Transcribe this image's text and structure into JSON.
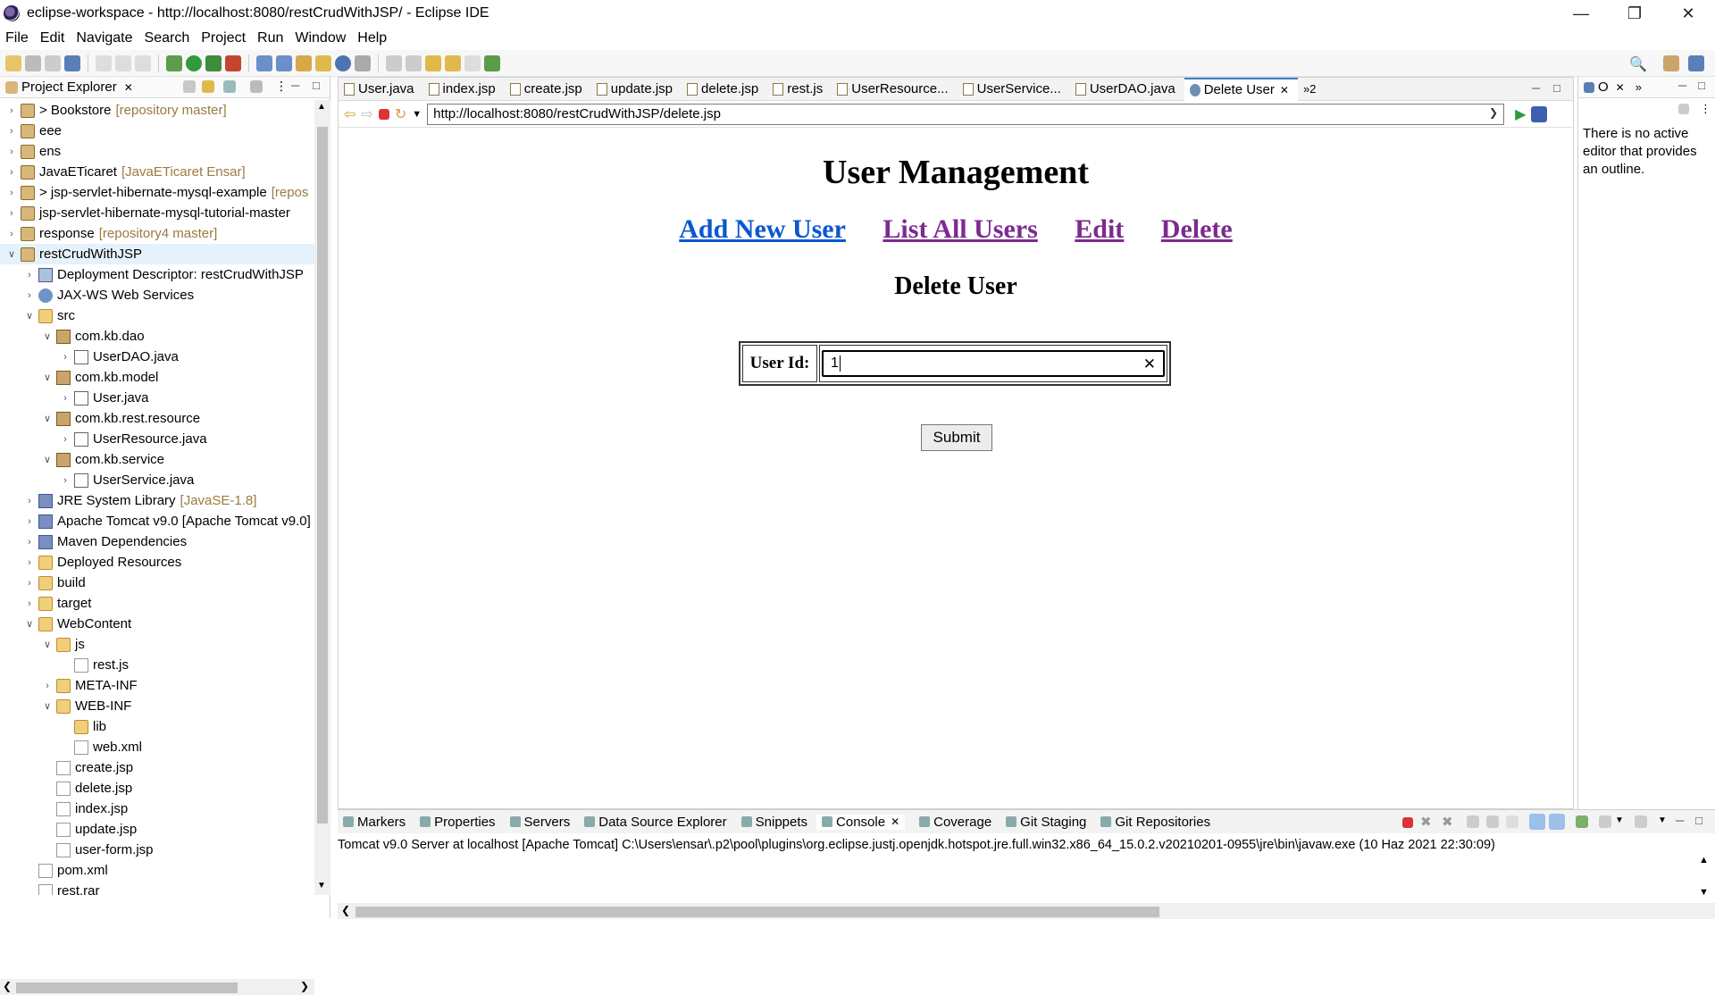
{
  "window": {
    "title": "eclipse-workspace - http://localhost:8080/restCrudWithJSP/ - Eclipse IDE"
  },
  "menu": [
    "File",
    "Edit",
    "Navigate",
    "Search",
    "Project",
    "Run",
    "Window",
    "Help"
  ],
  "explorer": {
    "title": "Project Explorer",
    "items": [
      {
        "label": "> Bookstore",
        "deco": "[repository master]",
        "indent": 0,
        "arrow": ">",
        "icon": "proj"
      },
      {
        "label": "eee",
        "deco": "",
        "indent": 0,
        "arrow": ">",
        "icon": "proj"
      },
      {
        "label": "ens",
        "deco": "",
        "indent": 0,
        "arrow": ">",
        "icon": "proj"
      },
      {
        "label": "JavaETicaret",
        "deco": "[JavaETicaret Ensar]",
        "indent": 0,
        "arrow": ">",
        "icon": "proj"
      },
      {
        "label": "> jsp-servlet-hibernate-mysql-example",
        "deco": "[repos",
        "indent": 0,
        "arrow": ">",
        "icon": "proj"
      },
      {
        "label": "jsp-servlet-hibernate-mysql-tutorial-master",
        "deco": "",
        "indent": 0,
        "arrow": ">",
        "icon": "proj"
      },
      {
        "label": "response",
        "deco": "[repository4 master]",
        "indent": 0,
        "arrow": ">",
        "icon": "proj"
      },
      {
        "label": "restCrudWithJSP",
        "deco": "",
        "indent": 0,
        "arrow": "v",
        "icon": "proj",
        "selected": true
      },
      {
        "label": "Deployment Descriptor: restCrudWithJSP",
        "deco": "",
        "indent": 1,
        "arrow": ">",
        "icon": "dd"
      },
      {
        "label": "JAX-WS Web Services",
        "deco": "",
        "indent": 1,
        "arrow": ">",
        "icon": "ws"
      },
      {
        "label": "src",
        "deco": "",
        "indent": 1,
        "arrow": "v",
        "icon": "folder"
      },
      {
        "label": "com.kb.dao",
        "deco": "",
        "indent": 2,
        "arrow": "v",
        "icon": "pkg"
      },
      {
        "label": "UserDAO.java",
        "deco": "",
        "indent": 3,
        "arrow": ">",
        "icon": "java"
      },
      {
        "label": "com.kb.model",
        "deco": "",
        "indent": 2,
        "arrow": "v",
        "icon": "pkg"
      },
      {
        "label": "User.java",
        "deco": "",
        "indent": 3,
        "arrow": ">",
        "icon": "java"
      },
      {
        "label": "com.kb.rest.resource",
        "deco": "",
        "indent": 2,
        "arrow": "v",
        "icon": "pkg"
      },
      {
        "label": "UserResource.java",
        "deco": "",
        "indent": 3,
        "arrow": ">",
        "icon": "java"
      },
      {
        "label": "com.kb.service",
        "deco": "",
        "indent": 2,
        "arrow": "v",
        "icon": "pkg"
      },
      {
        "label": "UserService.java",
        "deco": "",
        "indent": 3,
        "arrow": ">",
        "icon": "java"
      },
      {
        "label": "JRE System Library",
        "deco": "[JavaSE-1.8]",
        "indent": 1,
        "arrow": ">",
        "icon": "lib"
      },
      {
        "label": "Apache Tomcat v9.0 [Apache Tomcat v9.0]",
        "deco": "",
        "indent": 1,
        "arrow": ">",
        "icon": "lib"
      },
      {
        "label": "Maven Dependencies",
        "deco": "",
        "indent": 1,
        "arrow": ">",
        "icon": "lib"
      },
      {
        "label": "Deployed Resources",
        "deco": "",
        "indent": 1,
        "arrow": ">",
        "icon": "folder"
      },
      {
        "label": "build",
        "deco": "",
        "indent": 1,
        "arrow": ">",
        "icon": "folder"
      },
      {
        "label": "target",
        "deco": "",
        "indent": 1,
        "arrow": ">",
        "icon": "folder"
      },
      {
        "label": "WebContent",
        "deco": "",
        "indent": 1,
        "arrow": "v",
        "icon": "folder"
      },
      {
        "label": "js",
        "deco": "",
        "indent": 2,
        "arrow": "v",
        "icon": "folder"
      },
      {
        "label": "rest.js",
        "deco": "",
        "indent": 3,
        "arrow": "",
        "icon": "file"
      },
      {
        "label": "META-INF",
        "deco": "",
        "indent": 2,
        "arrow": ">",
        "icon": "folder"
      },
      {
        "label": "WEB-INF",
        "deco": "",
        "indent": 2,
        "arrow": "v",
        "icon": "folder"
      },
      {
        "label": "lib",
        "deco": "",
        "indent": 3,
        "arrow": "",
        "icon": "folder"
      },
      {
        "label": "web.xml",
        "deco": "",
        "indent": 3,
        "arrow": "",
        "icon": "file"
      },
      {
        "label": "create.jsp",
        "deco": "",
        "indent": 2,
        "arrow": "",
        "icon": "file"
      },
      {
        "label": "delete.jsp",
        "deco": "",
        "indent": 2,
        "arrow": "",
        "icon": "file"
      },
      {
        "label": "index.jsp",
        "deco": "",
        "indent": 2,
        "arrow": "",
        "icon": "file"
      },
      {
        "label": "update.jsp",
        "deco": "",
        "indent": 2,
        "arrow": "",
        "icon": "file"
      },
      {
        "label": "user-form.jsp",
        "deco": "",
        "indent": 2,
        "arrow": "",
        "icon": "file"
      },
      {
        "label": "pom.xml",
        "deco": "",
        "indent": 1,
        "arrow": "",
        "icon": "file"
      },
      {
        "label": "rest.rar",
        "deco": "",
        "indent": 1,
        "arrow": "",
        "icon": "file"
      }
    ]
  },
  "editor": {
    "tabs": [
      {
        "label": "User.java",
        "active": false
      },
      {
        "label": "index.jsp",
        "active": false
      },
      {
        "label": "create.jsp",
        "active": false
      },
      {
        "label": "update.jsp",
        "active": false
      },
      {
        "label": "delete.jsp",
        "active": false
      },
      {
        "label": "rest.js",
        "active": false
      },
      {
        "label": "UserResource...",
        "active": false
      },
      {
        "label": "UserService...",
        "active": false
      },
      {
        "label": "UserDAO.java",
        "active": false
      },
      {
        "label": "Delete User",
        "active": true
      }
    ],
    "overflow_label": "»2",
    "url": "http://localhost:8080/restCrudWithJSP/delete.jsp"
  },
  "webpage": {
    "heading": "User Management",
    "links": [
      {
        "label": "Add New User",
        "color": "#0b57d0"
      },
      {
        "label": "List All Users",
        "color": "#7d2a8f"
      },
      {
        "label": "Edit",
        "color": "#7d2a8f"
      },
      {
        "label": "Delete",
        "color": "#7d2a8f"
      }
    ],
    "subheading": "Delete User",
    "field_label": "User Id:",
    "field_value": "1",
    "submit_label": "Submit"
  },
  "outline": {
    "title": "O",
    "message": "There is no active editor that provides an outline."
  },
  "console": {
    "tabs": [
      {
        "label": "Markers",
        "active": false
      },
      {
        "label": "Properties",
        "active": false
      },
      {
        "label": "Servers",
        "active": false
      },
      {
        "label": "Data Source Explorer",
        "active": false
      },
      {
        "label": "Snippets",
        "active": false
      },
      {
        "label": "Console",
        "active": true
      },
      {
        "label": "Coverage",
        "active": false
      },
      {
        "label": "Git Staging",
        "active": false
      },
      {
        "label": "Git Repositories",
        "active": false
      }
    ],
    "line": "Tomcat v9.0 Server at localhost [Apache Tomcat] C:\\Users\\ensar\\.p2\\pool\\plugins\\org.eclipse.justj.openjdk.hotspot.jre.full.win32.x86_64_15.0.2.v20210201-0955\\jre\\bin\\javaw.exe  (10 Haz 2021 22:30:09)"
  }
}
